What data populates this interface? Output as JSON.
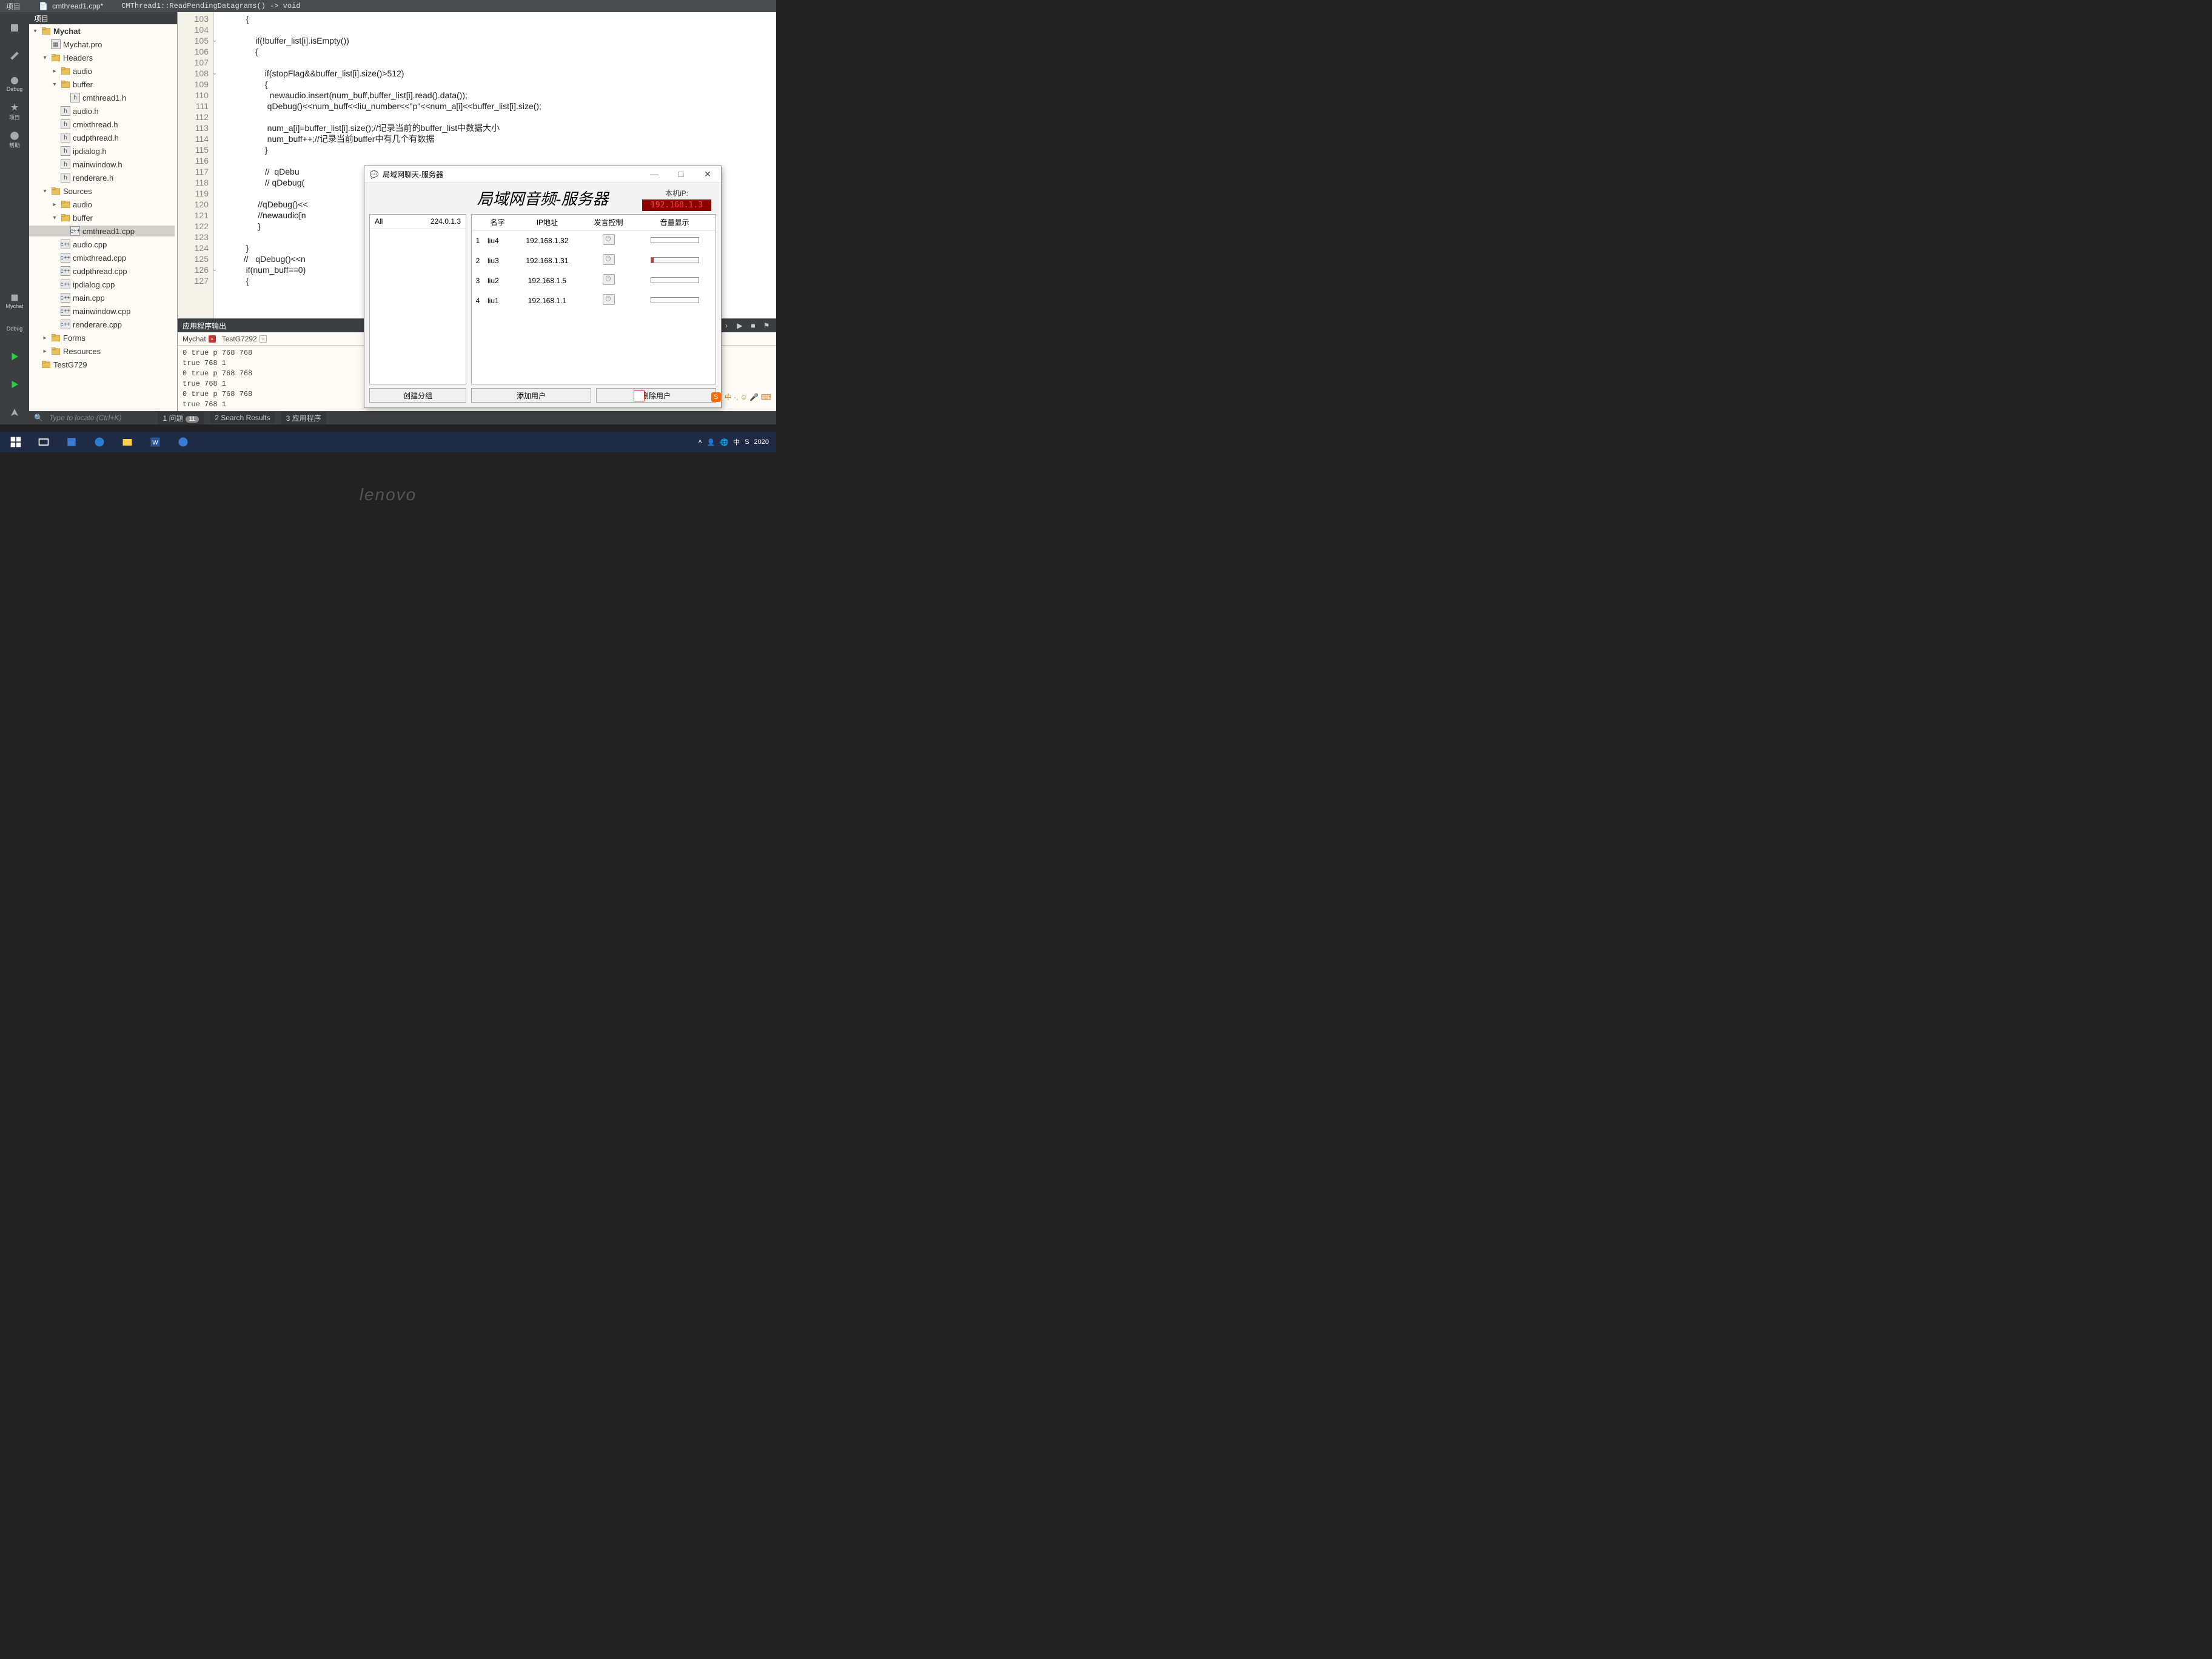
{
  "top": {
    "menu_item": "项目",
    "open_file": "cmthread1.cpp*",
    "breadcrumb": "CMThread1::ReadPendingDatagrams() -> void"
  },
  "tree_head": "项目",
  "tree": [
    {
      "d": 0,
      "tw": "▾",
      "ico": "proj",
      "label": "Mychat",
      "bold": true
    },
    {
      "d": 1,
      "tw": "",
      "ico": "pro",
      "label": "Mychat.pro"
    },
    {
      "d": 1,
      "tw": "▾",
      "ico": "folder",
      "label": "Headers"
    },
    {
      "d": 2,
      "tw": "▸",
      "ico": "folder",
      "label": "audio"
    },
    {
      "d": 2,
      "tw": "▾",
      "ico": "folder",
      "label": "buffer"
    },
    {
      "d": 3,
      "tw": "",
      "ico": "h",
      "label": "cmthread1.h"
    },
    {
      "d": 2,
      "tw": "",
      "ico": "h",
      "label": "audio.h"
    },
    {
      "d": 2,
      "tw": "",
      "ico": "h",
      "label": "cmixthread.h"
    },
    {
      "d": 2,
      "tw": "",
      "ico": "h",
      "label": "cudpthread.h"
    },
    {
      "d": 2,
      "tw": "",
      "ico": "h",
      "label": "ipdialog.h"
    },
    {
      "d": 2,
      "tw": "",
      "ico": "h",
      "label": "mainwindow.h"
    },
    {
      "d": 2,
      "tw": "",
      "ico": "h",
      "label": "renderare.h"
    },
    {
      "d": 1,
      "tw": "▾",
      "ico": "folder",
      "label": "Sources"
    },
    {
      "d": 2,
      "tw": "▸",
      "ico": "folder",
      "label": "audio"
    },
    {
      "d": 2,
      "tw": "▾",
      "ico": "folder",
      "label": "buffer"
    },
    {
      "d": 3,
      "tw": "",
      "ico": "c",
      "label": "cmthread1.cpp",
      "sel": true
    },
    {
      "d": 2,
      "tw": "",
      "ico": "c",
      "label": "audio.cpp"
    },
    {
      "d": 2,
      "tw": "",
      "ico": "c",
      "label": "cmixthread.cpp"
    },
    {
      "d": 2,
      "tw": "",
      "ico": "c",
      "label": "cudpthread.cpp"
    },
    {
      "d": 2,
      "tw": "",
      "ico": "c",
      "label": "ipdialog.cpp"
    },
    {
      "d": 2,
      "tw": "",
      "ico": "c",
      "label": "main.cpp"
    },
    {
      "d": 2,
      "tw": "",
      "ico": "c",
      "label": "mainwindow.cpp"
    },
    {
      "d": 2,
      "tw": "",
      "ico": "c",
      "label": "renderare.cpp"
    },
    {
      "d": 1,
      "tw": "▸",
      "ico": "folder",
      "label": "Forms"
    },
    {
      "d": 1,
      "tw": "▸",
      "ico": "folder",
      "label": "Resources"
    },
    {
      "d": 0,
      "tw": "",
      "ico": "proj",
      "label": "TestG729"
    }
  ],
  "lines": {
    "start": 103,
    "end": 127,
    "fold": [
      105,
      108,
      126
    ]
  },
  "code": "            {\n\n                if(!buffer_list[i].isEmpty())\n                {\n\n                    if(stopFlag&&buffer_list[i].size()>512)\n                    {\n                      newaudio.insert(num_buff,buffer_list[i].read().data());\n                     qDebug()<<num_buff<<liu_number<<\"p\"<<num_a[i]<<buffer_list[i].size();\n\n                     num_a[i]=buffer_list[i].size();//记录当前的buffer_list中数据大小\n                     num_buff++;//记录当前buffer中有几个有数据\n                    }\n\n                    //  qDebu\n                    // qDebug(\n\n                 //qDebug()<<\n                 //newaudio[n\n                 }\n\n            }\n           //   qDebug()<<n\n            if(num_buff==0)\n            {",
  "out": {
    "title": "应用程序输出",
    "tabs": [
      {
        "name": "Mychat",
        "close": "x"
      },
      {
        "name": "TestG7292",
        "close": "x2"
      }
    ],
    "text": "0 true p 768 768\ntrue 768 1\n0 true p 768 768\ntrue 768 1\n0 true p 768 768\ntrue 768 1"
  },
  "status": {
    "search": "Type to locate (Ctrl+K)",
    "tabs": [
      "1 问题",
      "2 Search Results",
      "3 应用程序"
    ],
    "badge": "11"
  },
  "ltool": {
    "mychat": "Mychat",
    "debug": "Debug",
    "xiangmu": "项目",
    "debug2": "Debug",
    "bangzhu": "帮助"
  },
  "app": {
    "wintitle": "局域网聊天-服务器",
    "heading": "局域网音频-服务器",
    "ip_label": "本机iP:",
    "ip_value": "192.168.1.3",
    "group": {
      "col1": "All",
      "col2": "224.0.1.3"
    },
    "headers": {
      "name": "名字",
      "ip": "IP地址",
      "talk": "发言控制",
      "vol": "音量显示"
    },
    "rows": [
      {
        "n": "1",
        "name": "liu4",
        "ip": "192.168.1.32",
        "vol": ""
      },
      {
        "n": "2",
        "name": "liu3",
        "ip": "192.168.1.31",
        "vol": "partial"
      },
      {
        "n": "3",
        "name": "liu2",
        "ip": "192.168.1.5",
        "vol": ""
      },
      {
        "n": "4",
        "name": "liu1",
        "ip": "192.168.1.1",
        "vol": ""
      }
    ],
    "btns": {
      "group": "创建分组",
      "add": "添加用户",
      "del": "删除用户"
    }
  },
  "tray": {
    "ime": "中",
    "icons": "中 ·, ☺ 🎤 ⌨"
  },
  "taskbar": {
    "year": "2020"
  },
  "brand": "lenovo"
}
